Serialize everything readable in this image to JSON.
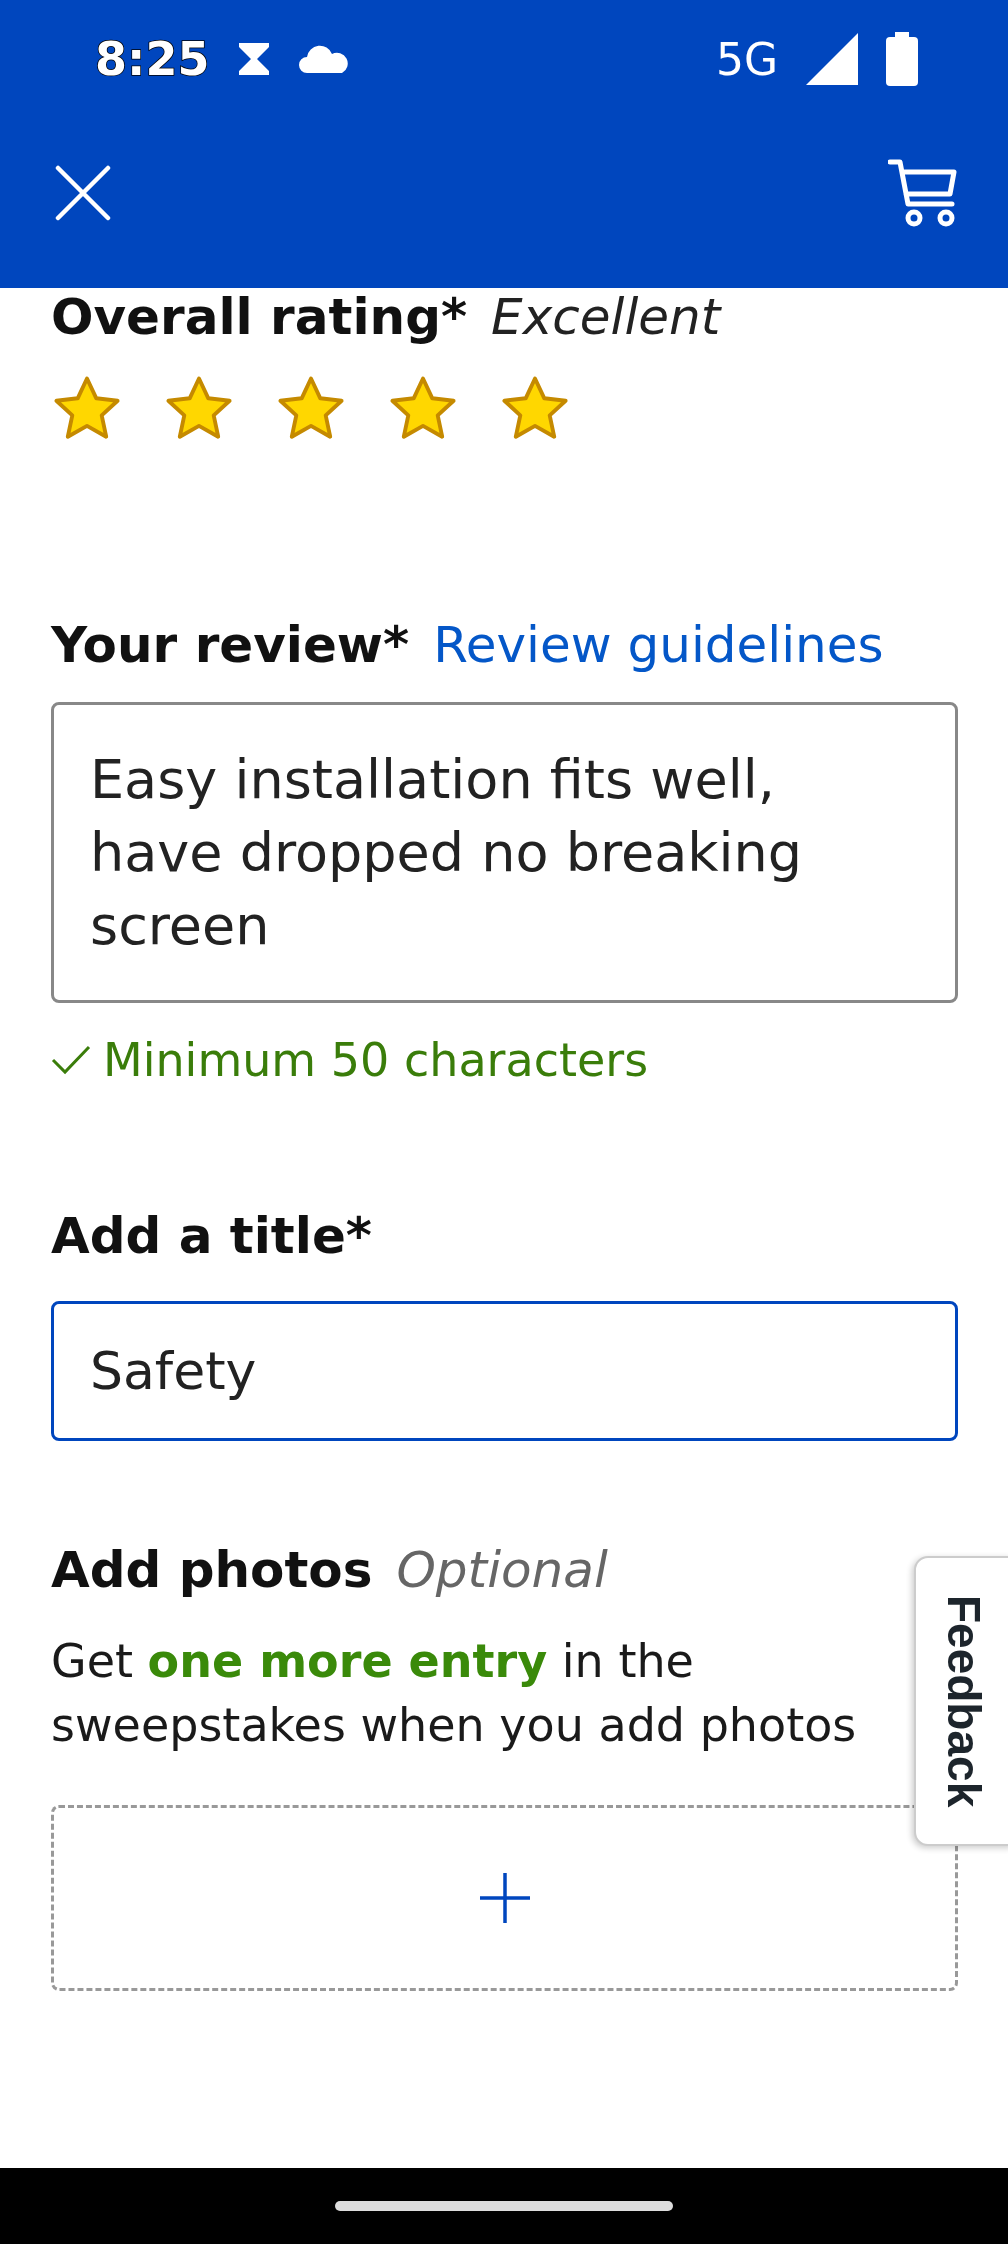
{
  "status_bar": {
    "time": "8:25",
    "network": "5G"
  },
  "rating": {
    "label": "Overall rating*",
    "value": "Excellent",
    "stars": 5
  },
  "review": {
    "label": "Your review*",
    "link": "Review guidelines",
    "value": "Easy installation fits well, have dropped no breaking screen",
    "hint": "Minimum 50 characters",
    "hint_met": true
  },
  "title_field": {
    "label": "Add a title*",
    "value": "Safety",
    "focused": true
  },
  "photos": {
    "label": "Add photos",
    "optional": "Optional",
    "text": "Get **one more entry** in the sweepstakes when you add photos"
  },
  "feedback_tab": "Feedback"
}
